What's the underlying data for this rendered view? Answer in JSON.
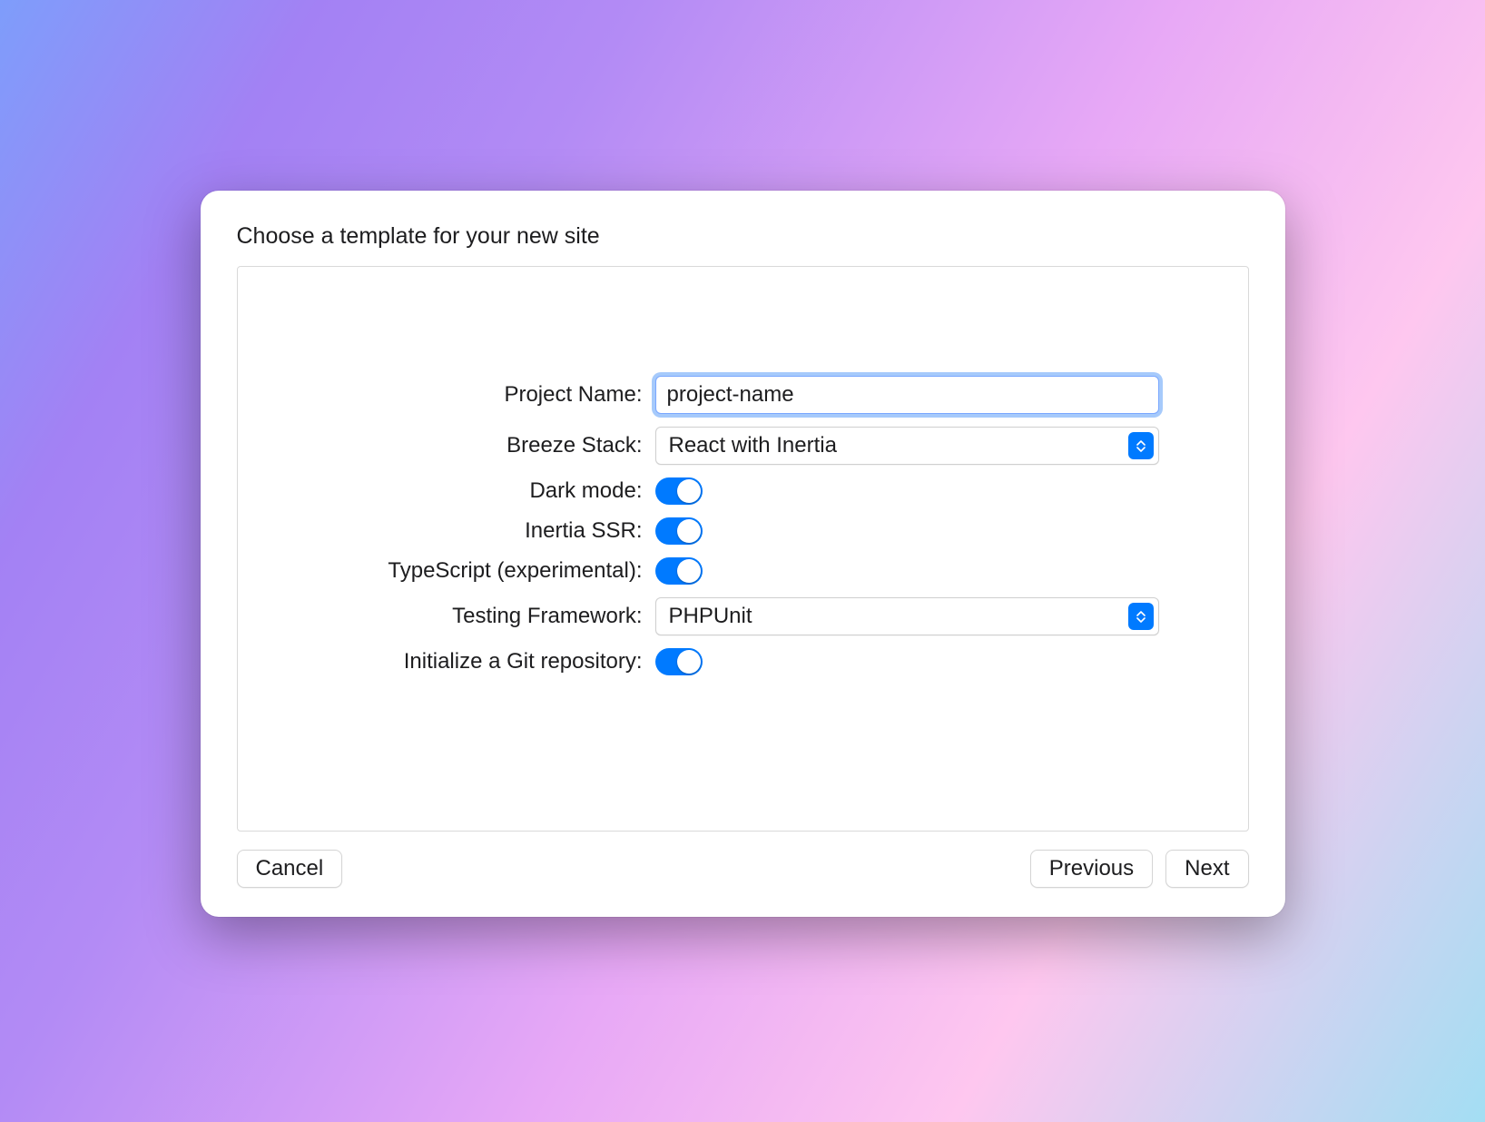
{
  "title": "Choose a template for your new site",
  "fields": {
    "projectName": {
      "label": "Project Name:",
      "value": "project-name"
    },
    "breezeStack": {
      "label": "Breeze Stack:",
      "value": "React with Inertia"
    },
    "darkMode": {
      "label": "Dark mode:",
      "value": true
    },
    "inertiaSSR": {
      "label": "Inertia SSR:",
      "value": true
    },
    "typescript": {
      "label": "TypeScript (experimental):",
      "value": true
    },
    "testing": {
      "label": "Testing Framework:",
      "value": "PHPUnit"
    },
    "gitRepo": {
      "label": "Initialize a Git repository:",
      "value": true
    }
  },
  "buttons": {
    "cancel": "Cancel",
    "previous": "Previous",
    "next": "Next"
  }
}
